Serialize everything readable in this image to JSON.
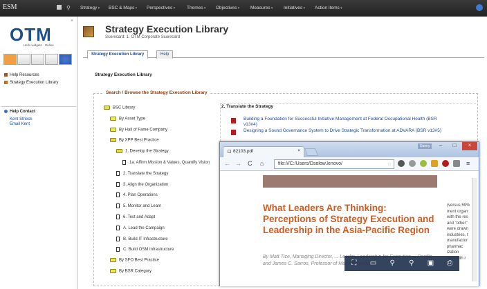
{
  "topbar": {
    "logo": "ESM",
    "menu": [
      "Strategy",
      "BSC & Maps",
      "Perspectives",
      "Themes",
      "Objectives",
      "Measures",
      "Initiatives",
      "Action Items"
    ]
  },
  "sidebar": {
    "logo": "OTM",
    "logo_sub": "Hello widgets · Online",
    "items": [
      {
        "label": "Help Resources"
      },
      {
        "label": "Strategy Execution Library"
      }
    ],
    "contact_title": "Help Contact",
    "contact_name": "Kent Strieck",
    "contact_email": "Email Kent"
  },
  "header": {
    "title": "Strategy Execution Library",
    "subtitle": "Scorecard: 1. OTM Corporate Scorecard"
  },
  "tabs": [
    {
      "label": "Strategy Execution Library"
    },
    {
      "label": "Help"
    }
  ],
  "library_label": "Strategy Execution Library",
  "fieldset_legend": "Search / Browse the Strategy Execution Library",
  "tree": [
    {
      "label": "BSC Library",
      "type": "folder-open",
      "indent": 0
    },
    {
      "label": "By Asset Type",
      "type": "folder",
      "indent": 1
    },
    {
      "label": "By Hall of Fame Company",
      "type": "folder",
      "indent": 1
    },
    {
      "label": "By XPP Best Practice",
      "type": "folder-open",
      "indent": 1
    },
    {
      "label": "1. Develop the Strategy",
      "type": "folder-open",
      "indent": 2
    },
    {
      "label": "1a. Affirm Mission & Values, Quantify Vision",
      "type": "doc",
      "indent": 3
    },
    {
      "label": "2. Translate the Strategy",
      "type": "doc",
      "indent": 2
    },
    {
      "label": "3. Align the Organization",
      "type": "doc",
      "indent": 2
    },
    {
      "label": "4. Plan Operations",
      "type": "doc",
      "indent": 2
    },
    {
      "label": "5. Monitor and Learn",
      "type": "doc",
      "indent": 2
    },
    {
      "label": "6. Test and Adapt",
      "type": "doc",
      "indent": 2
    },
    {
      "label": "A. Lead the Campaign",
      "type": "doc",
      "indent": 2
    },
    {
      "label": "B. Build IT Infrastructure",
      "type": "doc",
      "indent": 2
    },
    {
      "label": "C. Build OSM Infrastructure",
      "type": "doc",
      "indent": 2
    },
    {
      "label": "By SFO Best Practice",
      "type": "folder",
      "indent": 1
    },
    {
      "label": "By BSR Category",
      "type": "folder",
      "indent": 1
    }
  ],
  "right": {
    "heading": "2. Translate the Strategy",
    "links": [
      "Building a Foundation for Successful Initiative Management at Federal Occupational Health (BSR v13#4)",
      "Designing a Sound Governance System to Drive Strategic Transformation at ADVARA (BSR v13#5)"
    ]
  },
  "pdfwin": {
    "tab_title": "82103.pdf",
    "url": "file:///C:/Users/Dsolow.lenovo/",
    "title_label": "Danny",
    "heading": "What Leaders Are Thinking: Perceptions of Strategy Execution and Leadership in the Asia-Pacific Region",
    "byline": "By Matt Tice, Managing Director, ... Leader, Leadership for Execution ... Pacific and James C. Sarros, Professor of Management and",
    "sidetext": [
      "(versus 59%",
      "ment organ",
      "with the res",
      "and \"other\"",
      "were drawn",
      "industries, t",
      "manufactur",
      "pharmac",
      "ization",
      "ses) with r"
    ]
  },
  "colors": {
    "accent": "#d15a1e",
    "link": "#1a4a9a",
    "topbar": "#2b2b2b"
  }
}
